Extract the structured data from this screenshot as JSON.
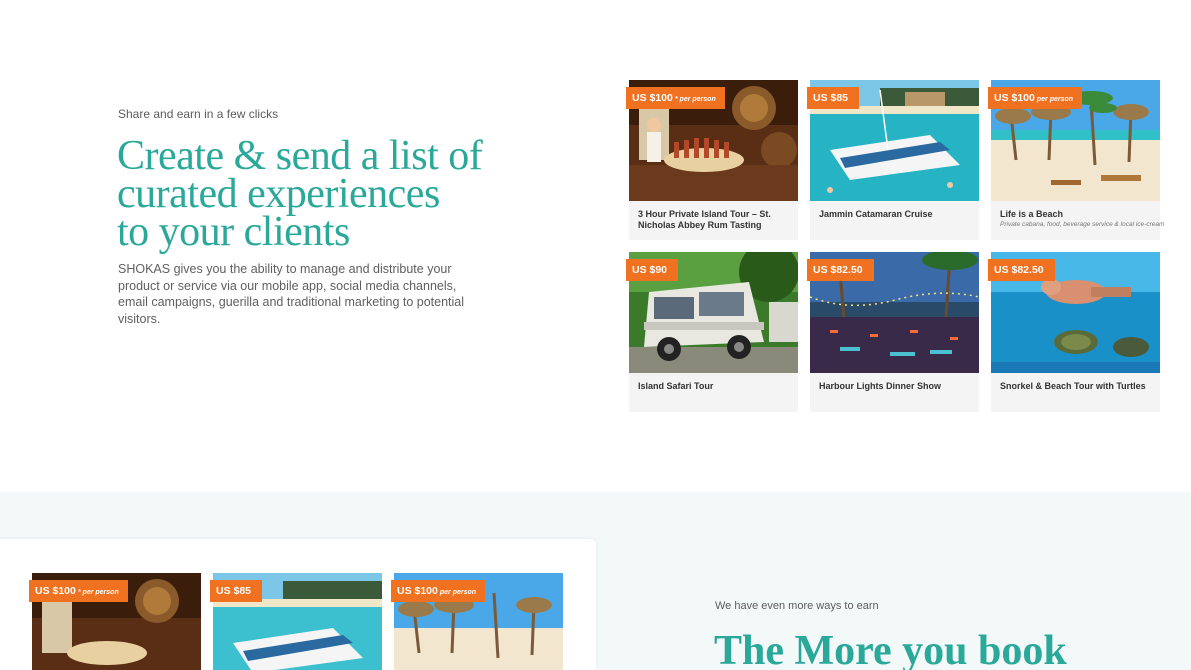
{
  "hero": {
    "eyebrow": "Share and earn in a few clicks",
    "headline_lines": [
      "Create & send a list of",
      "curated experiences",
      "to your clients"
    ],
    "description": "SHOKAS gives you the ability to manage and distribute your product or service via our mobile app, social media channels, email campaigns, guerilla and traditional marketing to potential visitors."
  },
  "cards": [
    {
      "price": "US $100",
      "price_suffix": "* per person",
      "title": "3 Hour Private Island Tour – St. Nicholas Abbey Rum Tasting",
      "subtitle": ""
    },
    {
      "price": "US $85",
      "price_suffix": "",
      "title": "Jammin Catamaran Cruise",
      "subtitle": ""
    },
    {
      "price": "US $100",
      "price_suffix": "per person",
      "title": "Life is a Beach",
      "subtitle": "Private cabana, food, beverage service & local ice-cream"
    },
    {
      "price": "US $90",
      "price_suffix": "",
      "title": "Island Safari Tour",
      "subtitle": ""
    },
    {
      "price": "US $82.50",
      "price_suffix": "",
      "title": "Harbour Lights Dinner Show",
      "subtitle": ""
    },
    {
      "price": "US $82.50",
      "price_suffix": "",
      "title": "Snorkel & Beach Tour with Turtles",
      "subtitle": ""
    }
  ],
  "bottom": {
    "cards": [
      {
        "price": "US $100",
        "price_suffix": "* per person"
      },
      {
        "price": "US $85",
        "price_suffix": ""
      },
      {
        "price": "US $100",
        "price_suffix": "per person"
      }
    ],
    "eyebrow": "We have even more ways to earn",
    "headline": "The More you book"
  },
  "colors": {
    "accent": "#2aa89a",
    "price_tag": "#f0711f",
    "section_bg": "#f3f8f8"
  }
}
